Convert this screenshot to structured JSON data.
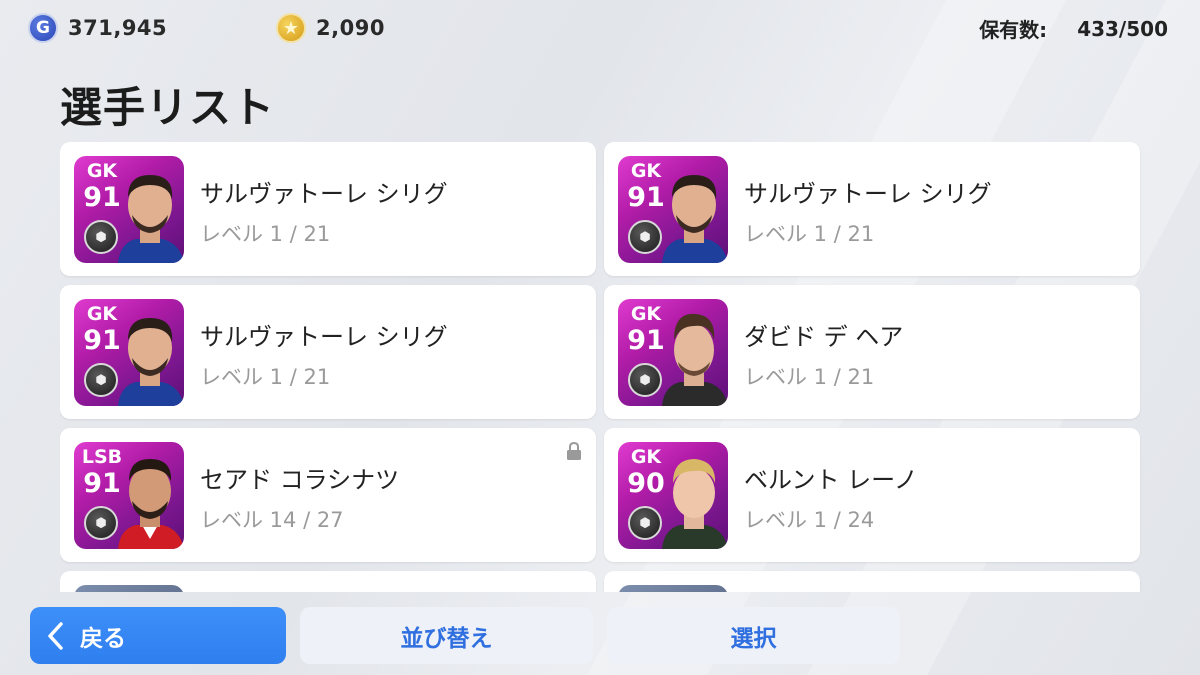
{
  "topbar": {
    "gp_icon": "G",
    "gp_value": "371,945",
    "coin_icon": "★",
    "coin_value": "2,090",
    "ownership_label": "保有数:",
    "ownership_value": "433/500"
  },
  "page_title": "選手リスト",
  "players": [
    {
      "position": "GK",
      "rating": "91",
      "name": "サルヴァトーレ シリグ",
      "level": "レベル 1 / 21",
      "locked": false
    },
    {
      "position": "GK",
      "rating": "91",
      "name": "サルヴァトーレ シリグ",
      "level": "レベル 1 / 21",
      "locked": false
    },
    {
      "position": "GK",
      "rating": "91",
      "name": "サルヴァトーレ シリグ",
      "level": "レベル 1 / 21",
      "locked": false
    },
    {
      "position": "GK",
      "rating": "91",
      "name": "ダビド デ ヘア",
      "level": "レベル 1 / 21",
      "locked": false
    },
    {
      "position": "LSB",
      "rating": "91",
      "name": "セアド コラシナツ",
      "level": "レベル 14 / 27",
      "locked": true
    },
    {
      "position": "GK",
      "rating": "90",
      "name": "ベルント レーノ",
      "level": "レベル 1 / 24",
      "locked": false
    }
  ],
  "buttons": {
    "back_label": "戻る",
    "sort_label": "並び替え",
    "select_label": "選択"
  },
  "colors": {
    "accent_blue": "#2f7ff0",
    "card_magenta": "#b21ca8"
  }
}
